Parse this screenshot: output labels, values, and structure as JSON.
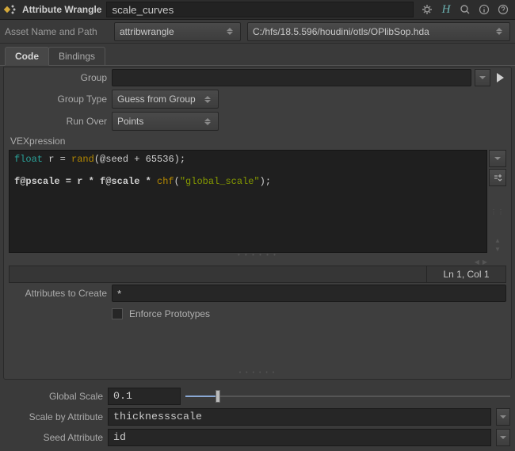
{
  "header": {
    "type_label": "Attribute Wrangle",
    "node_name": "scale_curves"
  },
  "asset": {
    "label": "Asset Name and Path",
    "name": "attribwrangle",
    "path": "C:/hfs/18.5.596/houdini/otls/OPlibSop.hda"
  },
  "tabs": {
    "code": "Code",
    "bindings": "Bindings"
  },
  "params": {
    "group_label": "Group",
    "group_value": "",
    "grouptype_label": "Group Type",
    "grouptype_value": "Guess from Group",
    "runover_label": "Run Over",
    "runover_value": "Points",
    "vex_label": "VEXpression",
    "status": "Ln 1, Col 1",
    "attrs_label": "Attributes to Create",
    "attrs_value": "*",
    "enforce_label": "Enforce Prototypes"
  },
  "code": {
    "line1_kw": "float",
    "line1_mid": " r = ",
    "line1_fn": "rand",
    "line1_rest": "(@seed + 65536);",
    "line2_lhs": "f@pscale = r * f@scale * ",
    "line2_fn": "chf",
    "line2_p1": "(",
    "line2_str": "\"global_scale\"",
    "line2_p2": ");"
  },
  "bottom": {
    "global_scale_label": "Global Scale",
    "global_scale_value": "0.1",
    "scale_attr_label": "Scale by Attribute",
    "scale_attr_value": "thicknessscale",
    "seed_attr_label": "Seed Attribute",
    "seed_attr_value": "id"
  }
}
